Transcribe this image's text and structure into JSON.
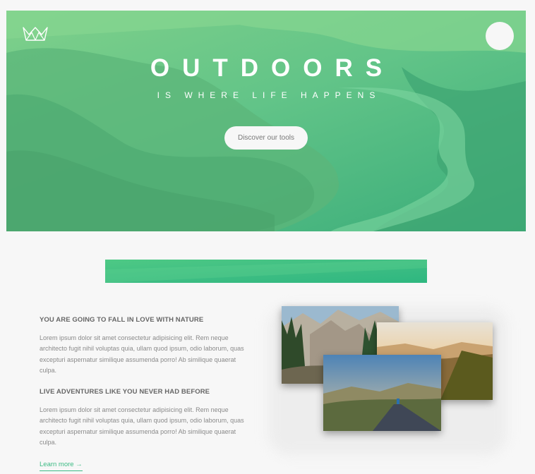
{
  "hero": {
    "title": "OUTDOORS",
    "subtitle": "IS WHERE LIFE HAPPENS",
    "cta_label": "Discover our tools"
  },
  "sections": [
    {
      "heading": "YOU ARE GOING TO FALL IN LOVE WITH NATURE",
      "body": "Lorem ipsum dolor sit amet consectetur adipisicing elit. Rem neque architecto fugit nihil voluptas quia, ullam quod ipsum, odio laborum, quas excepturi aspernatur similique assumenda porro! Ab similique quaerat culpa."
    },
    {
      "heading": "LIVE ADVENTURES LIKE YOU NEVER HAD BEFORE",
      "body": "Lorem ipsum dolor sit amet consectetur adipisicing elit. Rem neque architecto fugit nihil voluptas quia, ullam quod ipsum, odio laborum, quas excepturi aspernatur similique assumenda porro! Ab similique quaerat culpa."
    }
  ],
  "learn_more_label": "Learn more →",
  "icons": {
    "logo": "crown-logo-icon",
    "menu": "menu-toggle-icon"
  },
  "colors": {
    "accent": "#3dba85",
    "hero_green": "#62c488",
    "background": "#f7f7f7"
  }
}
